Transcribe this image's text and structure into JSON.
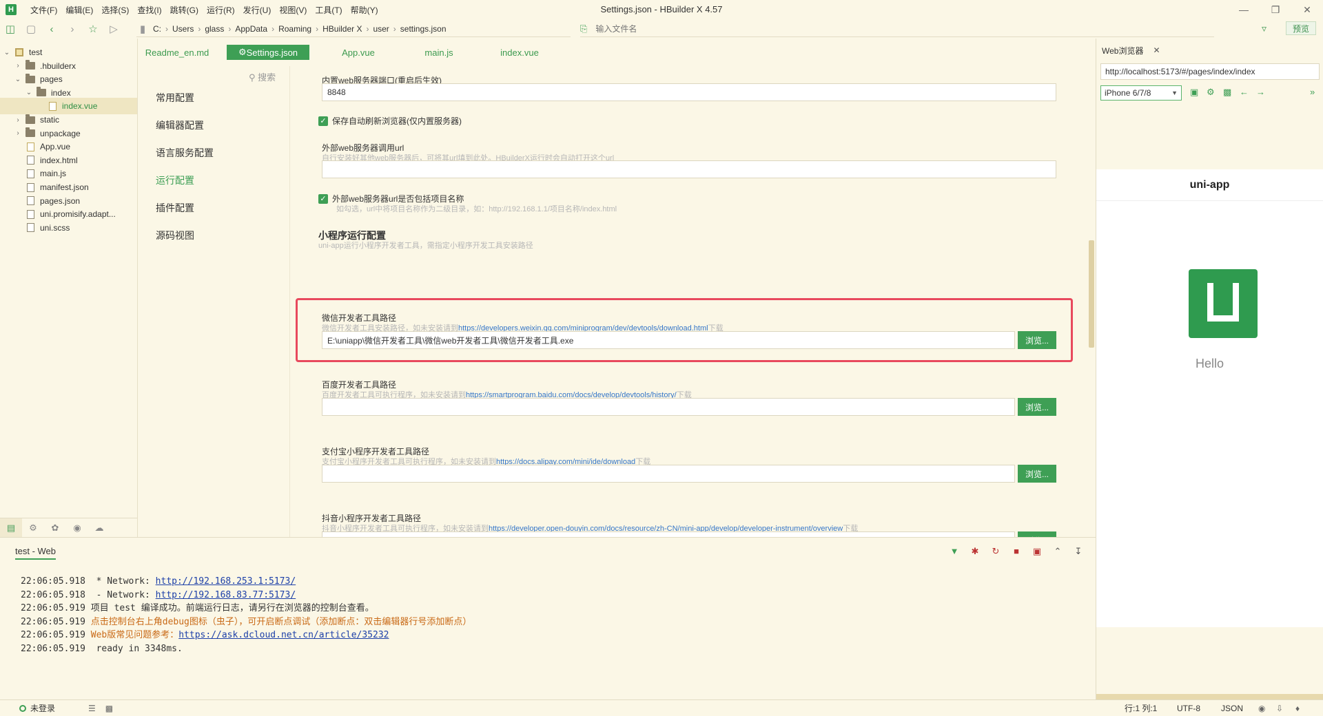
{
  "app": {
    "title": "Settings.json - HBuilder X 4.57",
    "logo_letter": "H"
  },
  "menu": [
    "文件(F)",
    "编辑(E)",
    "选择(S)",
    "查找(I)",
    "跳转(G)",
    "运行(R)",
    "发行(U)",
    "视图(V)",
    "工具(T)",
    "帮助(Y)"
  ],
  "toolbar": {
    "breadcrumb": [
      "C:",
      "Users",
      "glass",
      "AppData",
      "Roaming",
      "HBuilder X",
      "user",
      "settings.json"
    ],
    "file_search_placeholder": "输入文件名",
    "preview_label": "预览"
  },
  "tree": {
    "rows": [
      {
        "label": "test",
        "type": "project",
        "arrow": "v",
        "indent": 0
      },
      {
        "label": ".hbuilderx",
        "type": "folder",
        "arrow": ">",
        "indent": 1
      },
      {
        "label": "pages",
        "type": "folder",
        "arrow": "v",
        "indent": 1
      },
      {
        "label": "index",
        "type": "folder",
        "arrow": "v",
        "indent": 2
      },
      {
        "label": "index.vue",
        "type": "file",
        "arrow": "",
        "indent": 3,
        "selected": true
      },
      {
        "label": "static",
        "type": "folder",
        "arrow": ">",
        "indent": 1
      },
      {
        "label": "unpackage",
        "type": "folder",
        "arrow": ">",
        "indent": 1
      },
      {
        "label": "App.vue",
        "type": "file",
        "arrow": "",
        "indent": 1
      },
      {
        "label": "index.html",
        "type": "file",
        "arrow": "",
        "indent": 1
      },
      {
        "label": "main.js",
        "type": "file",
        "arrow": "",
        "indent": 1
      },
      {
        "label": "manifest.json",
        "type": "file",
        "arrow": "",
        "indent": 1
      },
      {
        "label": "pages.json",
        "type": "file",
        "arrow": "",
        "indent": 1
      },
      {
        "label": "uni.promisify.adapt...",
        "type": "file",
        "arrow": "",
        "indent": 1
      },
      {
        "label": "uni.scss",
        "type": "file",
        "arrow": "",
        "indent": 1
      }
    ]
  },
  "editor_tabs": [
    "Readme_en.md",
    "Settings.json",
    "App.vue",
    "main.js",
    "index.vue"
  ],
  "active_tab": "Settings.json",
  "settings": {
    "search_label": "搜索",
    "nav": [
      "常用配置",
      "编辑器配置",
      "语言服务配置",
      "运行配置",
      "插件配置",
      "源码视图"
    ],
    "active_nav": "运行配置",
    "web_port_label": "内置web服务器端口(重启后生效)",
    "web_port_value": "8848",
    "auto_refresh_label": "保存自动刷新浏览器(仅内置服务器)",
    "ext_url_label": "外部web服务器调用url",
    "ext_url_hint": "自行安装好其他web服务器后，可将其url填到此处。HBuilderX运行时会自动打开这个url",
    "include_project_label": "外部web服务器url是否包括项目名称",
    "include_project_hint": "如勾选，url中将项目名称作为二级目录，如：http://192.168.1.1/项目名称/index.html",
    "mp_section_title": "小程序运行配置",
    "mp_section_hint": "uni-app运行小程序开发者工具，需指定小程序开发工具安装路径",
    "browse_label": "浏览...",
    "hint_prefix_install": "如未安装请到",
    "hint_download": "下载",
    "tools": [
      {
        "label": "微信开发者工具路径",
        "hint_pre": "微信开发者工具安装路径，如未安装请到",
        "link": "https://developers.weixin.qq.com/miniprogram/dev/devtools/download.html",
        "value": "E:\\uniapp\\微信开发者工具\\微信web开发者工具\\微信开发者工具.exe"
      },
      {
        "label": "百度开发者工具路径",
        "hint_pre": "百度开发者工具可执行程序，如未安装请到",
        "link": "https://smartprogram.baidu.com/docs/develop/devtools/history/",
        "value": ""
      },
      {
        "label": "支付宝小程序开发者工具路径",
        "hint_pre": "支付宝小程序开发者工具可执行程序，如未安装请到",
        "link": "https://docs.alipay.com/mini/ide/download",
        "value": ""
      },
      {
        "label": "抖音小程序开发者工具路径",
        "hint_pre": "抖音小程序开发者工具可执行程序，如未安装请到",
        "link": "https://developer.open-douyin.com/docs/resource/zh-CN/mini-app/develop/developer-instrument/overview",
        "value": ""
      }
    ]
  },
  "browser": {
    "tab_label": "Web浏览器",
    "url": "http://localhost:5173/#/pages/index/index",
    "device": "iPhone 6/7/8",
    "page_title": "uni-app",
    "hello": "Hello"
  },
  "console": {
    "tab_label": "test - Web",
    "lines": [
      {
        "time": "22:06:05.918",
        "msg": "  * Network: ",
        "link": "http://192.168.253.1:5173/",
        "warn": false
      },
      {
        "time": "22:06:05.918",
        "msg": "  - Network: ",
        "link": "http://192.168.83.77:5173/",
        "warn": false
      },
      {
        "time": "22:06:05.919",
        "msg": " 项目 test 编译成功。前端运行日志，请另行在浏览器的控制台查看。",
        "link": "",
        "warn": false
      },
      {
        "time": "22:06:05.919",
        "msg": " 点击控制台右上角debug图标（虫子），可开启断点调试（添加断点：双击编辑器行号添加断点）",
        "link": "",
        "warn": true
      },
      {
        "time": "22:06:05.919",
        "msg": " Web版常见问题参考：",
        "link": "https://ask.dcloud.net.cn/article/35232",
        "warn": true
      },
      {
        "time": "22:06:05.919",
        "msg": "  ready in 3348ms.",
        "link": "",
        "warn": false
      }
    ]
  },
  "status": {
    "login": "未登录",
    "position": "行:1  列:1",
    "encoding": "UTF-8",
    "language": "JSON"
  }
}
